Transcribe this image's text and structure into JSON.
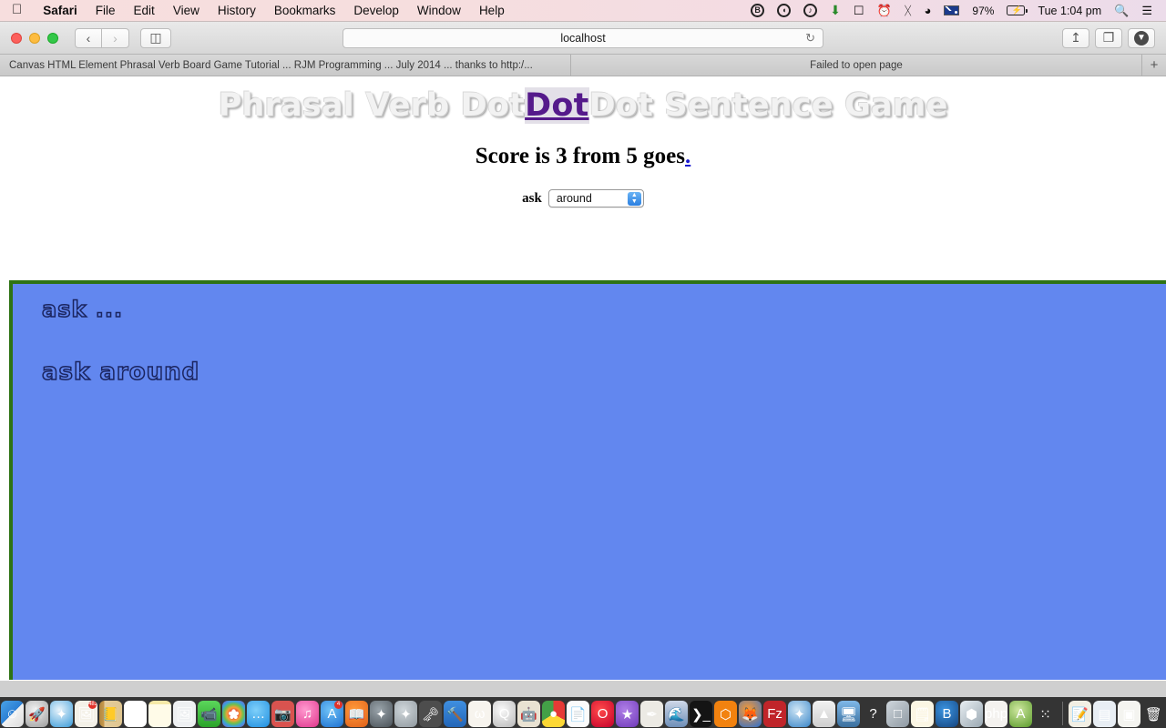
{
  "menubar": {
    "apple_icon": "apple-logo",
    "items": [
      {
        "label": "Safari",
        "bold": true
      },
      {
        "label": "File",
        "bold": false
      },
      {
        "label": "Edit",
        "bold": false
      },
      {
        "label": "View",
        "bold": false
      },
      {
        "label": "History",
        "bold": false
      },
      {
        "label": "Bookmarks",
        "bold": false
      },
      {
        "label": "Develop",
        "bold": false
      },
      {
        "label": "Window",
        "bold": false
      },
      {
        "label": "Help",
        "bold": false
      }
    ],
    "status": {
      "battery_percent": "97%",
      "clock": "Tue 1:04 pm",
      "icons": [
        "bittorrent-icon",
        "spiral-icon",
        "volume-icon",
        "download-icon",
        "airplay-icon",
        "timemachine-icon",
        "bluetooth-icon",
        "wifi-icon",
        "flag-australia-icon",
        "battery-icon",
        "search-icon",
        "notification-center-icon"
      ]
    }
  },
  "browser": {
    "window_controls": [
      "close-button",
      "minimize-button",
      "zoom-button"
    ],
    "back_label": "‹",
    "forward_label": "›",
    "sidebar_label": "sidebar-icon",
    "url": "localhost",
    "reload_label": "↻",
    "share_label": "share-icon",
    "tabs_overview_label": "tabs-icon",
    "downloads_label": "downloads-icon",
    "tabs": [
      {
        "title": "Canvas HTML Element Phrasal Verb Board Game Tutorial ... RJM Programming ... July 2014 ... thanks to http:/..."
      },
      {
        "title": "Failed to open page"
      }
    ],
    "new_tab_label": "+"
  },
  "page": {
    "title_pre": "Phrasal Verb Dot",
    "title_link": "Dot",
    "title_post": "Dot Sentence Game",
    "score_text": "Score is 3 from 5 goes",
    "score_link": ".",
    "score_value": 3,
    "score_goes": 5,
    "select_label": "ask",
    "select_value": "around",
    "select_options": [
      "around"
    ],
    "canvas": {
      "border_color": "#2e7314",
      "background_color": "#6287ef",
      "text_color": "#1b2560",
      "lines": [
        "ask ...",
        "ask  around"
      ]
    }
  },
  "dock": {
    "items": [
      {
        "name": "finder",
        "glyph": "☺",
        "bg": "linear-gradient(135deg,#4aa3e8 0%,#2b7fd4 50%,#f2f2f2 50%,#dcdcdc 100%)",
        "running": true
      },
      {
        "name": "launchpad",
        "glyph": "🚀",
        "bg": "radial-gradient(circle at 40% 35%,#f2f2f2,#9d9d9d)",
        "running": false
      },
      {
        "name": "safari",
        "glyph": "✦",
        "bg": "radial-gradient(circle at 40% 35%,#e9f4fb,#3a9bd8)",
        "running": true
      },
      {
        "name": "photos-old",
        "glyph": "🖼",
        "bg": "#f4f1e8",
        "badge": "4820",
        "running": true
      },
      {
        "name": "contacts",
        "glyph": "📒",
        "bg": "linear-gradient(to right,#b3873f 0%,#c89a4d 22%,#e4cc9c 22%,#e0c690 100%)",
        "running": false
      },
      {
        "name": "calendar",
        "glyph": "1",
        "bg": "#ffffff",
        "badge": "",
        "running": false
      },
      {
        "name": "notes",
        "glyph": "",
        "bg": "linear-gradient(to bottom,#f6e9a8 0 14%,#fffbe8 14%)",
        "running": false
      },
      {
        "name": "preview",
        "glyph": "🖼",
        "bg": "#eef0f2",
        "running": false
      },
      {
        "name": "facetime",
        "glyph": "📹",
        "bg": "linear-gradient(to bottom,#5bd65b,#2aa32a)",
        "running": false
      },
      {
        "name": "photos",
        "glyph": "✿",
        "bg": "radial-gradient(circle,#fff 18%,#e8493d 20%,#f3a13a 38%,#6fc04a 55%,#3aa0dc 72%,#8b55c9 100%)",
        "running": false
      },
      {
        "name": "messages",
        "glyph": "…",
        "bg": "radial-gradient(circle at 40% 35%,#7fd0fa,#1e8ee0)",
        "running": true
      },
      {
        "name": "iphoto",
        "glyph": "📷",
        "bg": "#d9534f",
        "running": false
      },
      {
        "name": "itunes",
        "glyph": "♫",
        "bg": "radial-gradient(circle at 40% 35%,#ff9ad0,#e0368c)",
        "running": true
      },
      {
        "name": "app-store",
        "glyph": "A",
        "bg": "radial-gradient(circle at 40% 35%,#6fc3f7,#1c6fd0)",
        "badge": "4",
        "running": false
      },
      {
        "name": "ibooks",
        "glyph": "📖",
        "bg": "radial-gradient(circle at 40% 35%,#ff9a3a,#e0611a)",
        "running": false
      },
      {
        "name": "safari-tp",
        "glyph": "✦",
        "bg": "radial-gradient(circle at 40% 35%,#9aa4ab,#4a5258)",
        "running": false
      },
      {
        "name": "safari-tp2",
        "glyph": "✦",
        "bg": "radial-gradient(circle at 40% 35%,#cfd6da,#8f989e)",
        "running": false
      },
      {
        "name": "keychain",
        "glyph": "🗝",
        "bg": "#4d4d4d",
        "running": false
      },
      {
        "name": "xcode",
        "glyph": "🔨",
        "bg": "linear-gradient(to bottom,#3f8fe0,#2366b8)",
        "running": true
      },
      {
        "name": "wolfram",
        "glyph": "ω",
        "bg": "#f7f4ee",
        "running": true
      },
      {
        "name": "quicktime",
        "glyph": "Q",
        "bg": "radial-gradient(circle at 40% 35%,#fafafa,#b8b8b8)",
        "running": true
      },
      {
        "name": "automator",
        "glyph": "🤖",
        "bg": "#e9e2d2",
        "running": false
      },
      {
        "name": "chrome",
        "glyph": "●",
        "bg": "conic-gradient(#e53935 0 33%,#fdd835 0 66%,#43a047 0 100%)",
        "running": true
      },
      {
        "name": "textedit",
        "glyph": "📄",
        "bg": "#fbfbfb",
        "running": false
      },
      {
        "name": "opera",
        "glyph": "O",
        "bg": "radial-gradient(circle at 40% 35%,#ff4a4a,#c4002b)",
        "running": true
      },
      {
        "name": "imovie",
        "glyph": "★",
        "bg": "radial-gradient(circle at 40% 35%,#b07fe8,#6f39b8)",
        "running": false
      },
      {
        "name": "graphic-tool",
        "glyph": "✒",
        "bg": "#eceae4",
        "running": false
      },
      {
        "name": "seashore",
        "glyph": "🌊",
        "bg": "linear-gradient(to bottom,#cfd8e8,#6f8fb8)",
        "running": true
      },
      {
        "name": "terminal",
        "glyph": "❯_",
        "bg": "#141414",
        "running": true
      },
      {
        "name": "avast",
        "glyph": "⬡",
        "bg": "#f2820f",
        "running": true
      },
      {
        "name": "firefox",
        "glyph": "🦊",
        "bg": "radial-gradient(circle at 40% 35%,#ff9a2e,#2b6fd0)",
        "running": true
      },
      {
        "name": "filezilla",
        "glyph": "Fz",
        "bg": "#c0252a",
        "running": true
      },
      {
        "name": "safari-dev",
        "glyph": "✦",
        "bg": "radial-gradient(circle at 40% 35%,#cfe6f5,#3a86c8)",
        "running": false
      },
      {
        "name": "vlc",
        "glyph": "▲",
        "bg": "linear-gradient(to bottom,#f2f2f2,#cfcfcf)",
        "running": false
      },
      {
        "name": "remote-desktop",
        "glyph": "🖥",
        "bg": "linear-gradient(to bottom,#7fb8e8,#3a6f9e)",
        "running": false
      },
      {
        "name": "help",
        "glyph": "?",
        "bg": "transparent",
        "running": false
      },
      {
        "name": "virtualbox-box",
        "glyph": "□",
        "bg": "linear-gradient(135deg,#cfd6dc,#8f9aa3)",
        "running": false
      },
      {
        "name": "stickies",
        "glyph": "🗒",
        "bg": "#fbf6e4",
        "running": false
      },
      {
        "name": "bootstrap",
        "glyph": "B",
        "bg": "radial-gradient(circle at 40% 35%,#3a93e0,#15457f)",
        "running": false
      },
      {
        "name": "virtualbox",
        "glyph": "⬢",
        "bg": "linear-gradient(135deg,#e8eef2,#9aa8b2)",
        "running": false
      },
      {
        "name": "php-storm",
        "glyph": "php",
        "bg": "#f4f2ef",
        "running": false
      },
      {
        "name": "android-studio",
        "glyph": "A",
        "bg": "radial-gradient(circle at 40% 35%,#cfe8a0,#5a9a2a)",
        "running": true
      },
      {
        "name": "color-balls",
        "glyph": "⁙",
        "bg": "transparent",
        "running": true
      },
      {
        "name": "documents-stack",
        "glyph": "📝",
        "bg": "#f2efe4",
        "running": false
      },
      {
        "name": "downloads-stack",
        "glyph": "▤",
        "bg": "#e8eef4",
        "running": false
      },
      {
        "name": "desktop-stack",
        "glyph": "▣",
        "bg": "#f4f4f0",
        "running": false
      },
      {
        "name": "trash",
        "glyph": "🗑",
        "bg": "transparent",
        "running": false
      }
    ]
  }
}
